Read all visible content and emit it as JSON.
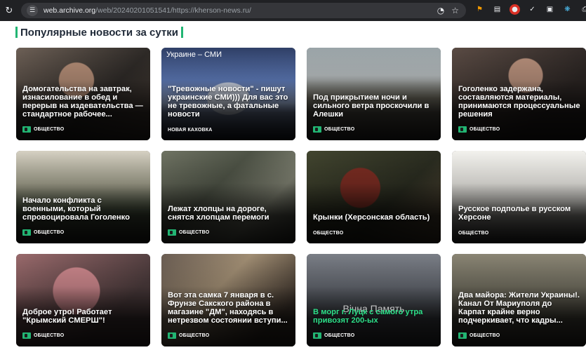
{
  "browser": {
    "reload_icon": "reload-icon",
    "url_host": "web.archive.org",
    "url_path": "/web/20240201051541/https://kherson-news.ru/",
    "icons": [
      "site-settings-icon",
      "zoom-icon",
      "bookmark-star-icon"
    ],
    "extensions": [
      "extension-icon-1",
      "extension-icon-2",
      "extension-icon-3",
      "extension-icon-4",
      "extension-icon-5",
      "extension-icon-6",
      "extensions-puzzle-icon"
    ]
  },
  "section": {
    "title": "Популярные новости за сутки",
    "accent": "#22b573"
  },
  "cards": [
    {
      "title": "Домогательства на завтрак, изнасилование в обед и перерыв на издевательства — стандартное рабочее...",
      "tag": "ОБЩЕСТВО",
      "has_cam": true
    },
    {
      "title": "\"Тревожные новости\" - пишут украинские СМИ))) Для вас это не тревожные, а фатальные новости",
      "tag": "НОВАЯ КАХОВКА",
      "has_cam": false,
      "top_caption": "Украине – СМИ"
    },
    {
      "title": "Под прикрытием ночи и сильного ветра проскочили в Алешки",
      "tag": "ОБЩЕСТВО",
      "has_cam": true
    },
    {
      "title": "Гоголенко задержана, составляются материалы, принимаются процессуальные решения",
      "tag": "ОБЩЕСТВО",
      "has_cam": true
    },
    {
      "title": "Начало конфликта с военными, который спровоцировала Гоголенко",
      "tag": "ОБЩЕСТВО",
      "has_cam": true
    },
    {
      "title": "Лежат хлопцы на дороге, снятся хлопцам перемоги",
      "tag": "ОБЩЕСТВО",
      "has_cam": true
    },
    {
      "title": "Крынки (Херсонская область)",
      "tag": "ОБЩЕСТВО",
      "has_cam": false
    },
    {
      "title": "Русское подполье в русском Херсоне",
      "tag": "ОБЩЕСТВО",
      "has_cam": false
    },
    {
      "title": "Доброе утро! Работает \"Крымский СМЕРШ\"!",
      "tag": "ОБЩЕСТВО",
      "has_cam": true
    },
    {
      "title": "Вот эта самка 7 января в с. Фрунзе Сакского района в магазине \"ДМ\", находясь в нетрезвом состоянии вступи...",
      "tag": "ОБЩЕСТВО",
      "has_cam": true
    },
    {
      "title": "В морг г. Луцк с самого утра привозят 200-ых",
      "tag": "ОБЩЕСТВО",
      "has_cam": true,
      "green_title": true,
      "watermark": "Вічна Память"
    },
    {
      "title": "Два майора: Жители Украины!. Канал От Мариуполя до Карпат крайне верно подчеркивает, что кадры...",
      "tag": "ОБЩЕСТВО",
      "has_cam": true
    }
  ]
}
